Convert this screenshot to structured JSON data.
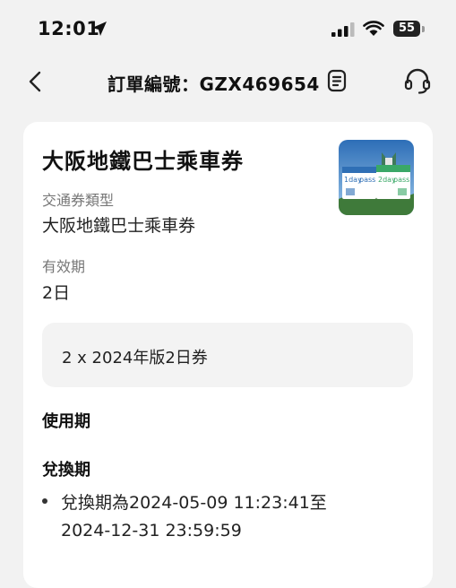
{
  "status_bar": {
    "time": "12:01",
    "battery_level": "55"
  },
  "header": {
    "title": "訂單編號：GZX469654"
  },
  "order": {
    "product_name": "大阪地鐵巴士乘車券",
    "pass_type_label": "交通券類型",
    "pass_type_value": "大阪地鐵巴士乘車券",
    "validity_label": "有效期",
    "validity_value": "2日",
    "selected_option": "2 x 2024年版2日券",
    "usage_period_heading": "使用期",
    "exchange_period_heading": "兌換期",
    "exchange_period_line1": "兌換期為2024-05-09 11:23:41至",
    "exchange_period_line2": "2024-12-31 23:59:59"
  },
  "product_image": {
    "card1_label": "1day",
    "card2_label": "2day",
    "card_word": "pass"
  },
  "colors": {
    "background": "#f2f2f2",
    "card": "#ffffff",
    "option_box": "#f3f3f3",
    "pass_blue": "#2f6fb5",
    "pass_green": "#3aa867"
  }
}
